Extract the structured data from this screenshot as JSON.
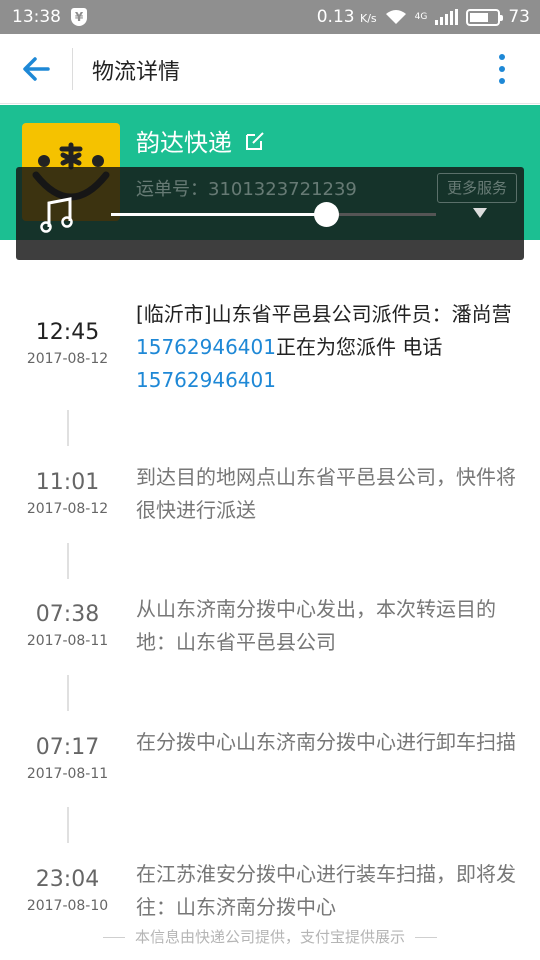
{
  "status_bar": {
    "time": "13:38",
    "net_speed": "0.13",
    "net_unit": "K/s",
    "battery": "73",
    "battery_level": 0.73,
    "signal_type": "4G"
  },
  "app_bar": {
    "title": "物流详情"
  },
  "header": {
    "courier_name": "韵达快递",
    "tracking_label": "运单号：3101323721239",
    "more_services": "更多服务",
    "bg_color": "#1cbf92"
  },
  "player": {
    "progress": 0.66
  },
  "timeline": [
    {
      "time": "12:45",
      "date": "2017-08-12",
      "text_1": "[临沂市]山东省平邑县公司派件员：潘尚营",
      "phone_1": "15762946401",
      "text_2": "正在为您派件 电话",
      "phone_2": "15762946401"
    },
    {
      "time": "11:01",
      "date": "2017-08-12",
      "text": "到达目的地网点山东省平邑县公司，快件将很快进行派送"
    },
    {
      "time": "07:38",
      "date": "2017-08-11",
      "text": "从山东济南分拨中心发出，本次转运目的地：山东省平邑县公司"
    },
    {
      "time": "07:17",
      "date": "2017-08-11",
      "text": "在分拨中心山东济南分拨中心进行卸车扫描"
    },
    {
      "time": "23:04",
      "date": "2017-08-10",
      "text": "在江苏淮安分拨中心进行装车扫描，即将发往：山东济南分拨中心"
    }
  ],
  "footer": {
    "text": "本信息由快递公司提供，支付宝提供展示"
  },
  "colors": {
    "accent": "#1e88d6",
    "header_green": "#1cbf92",
    "logo_yellow": "#f5c200"
  }
}
